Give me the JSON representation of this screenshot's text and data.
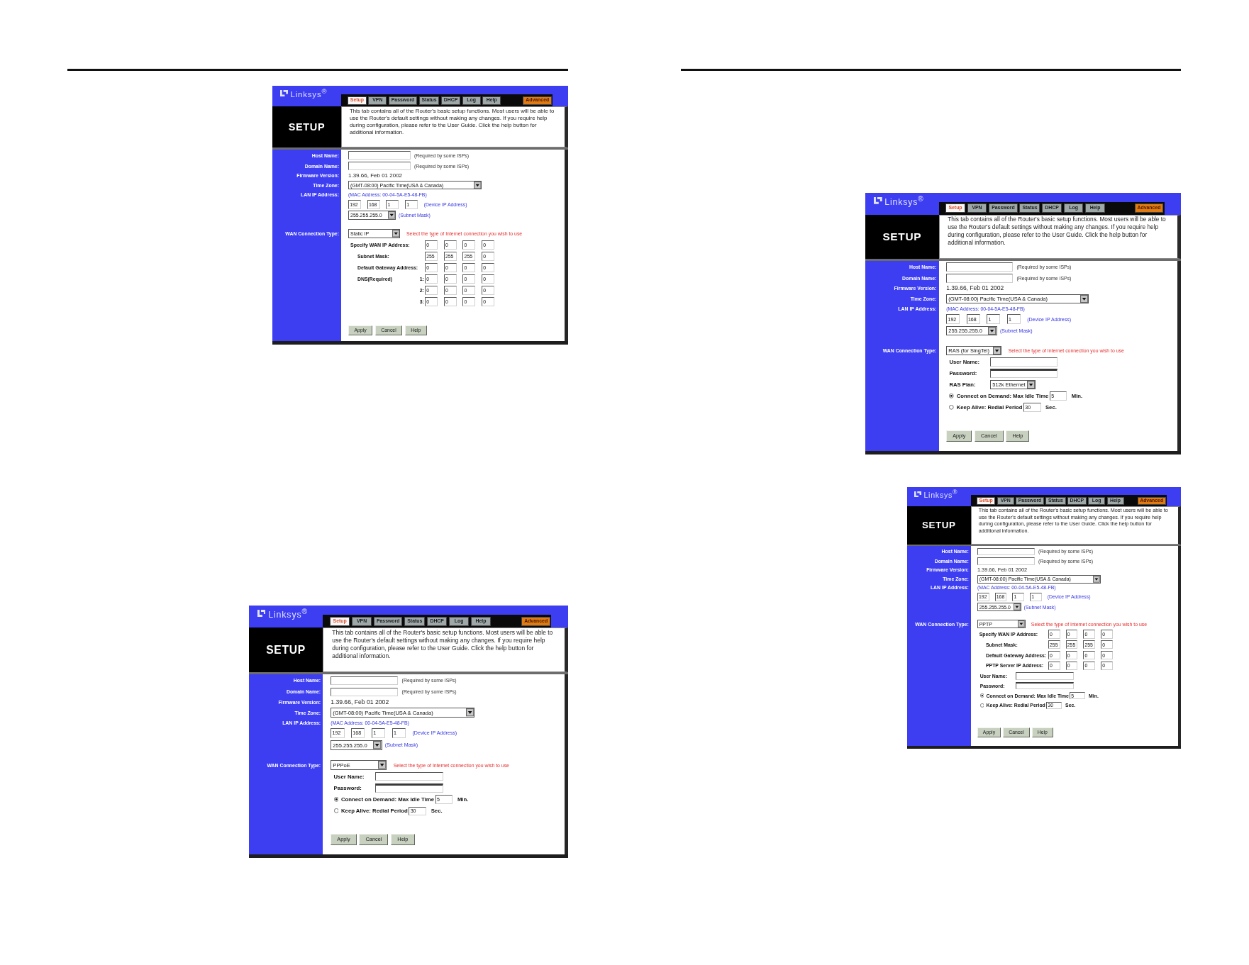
{
  "left_page": {
    "screenshots": [
      {
        "logo": "Linksys$^{®}$",
        "tabs": [
          {
            "label": "Setup",
            "kind": "plain",
            "selected": true
          },
          {
            "label": "VPN",
            "kind": "plain",
            "selected": false
          },
          {
            "label": "Password",
            "kind": "plain",
            "selected": false
          },
          {
            "label": "Status",
            "kind": "plain",
            "selected": false
          },
          {
            "label": "DHCP",
            "kind": "plain",
            "selected": false
          },
          {
            "label": "Log",
            "kind": "plain",
            "selected": false
          },
          {
            "label": "Help",
            "kind": "plain",
            "selected": false
          },
          {
            "label": "Advanced",
            "kind": "accent",
            "selected": false
          }
        ],
        "title": "SETUP",
        "description": "This tab contains all of the Router's basic setup functions. Most users will be able to use the Router's default settings without making any changes. If you require help during configuration, please refer to the User Guide. Click the help button for additional information.",
        "host_name": {
          "label": "Host Name:",
          "note": "(Required by some ISPs)"
        },
        "domain_name": {
          "label": "Domain Name:",
          "note": "(Required by some ISPs)"
        },
        "firmware_version": {
          "label": "Firmware Version:",
          "value": "1.39.66, Feb 01 2002"
        },
        "time_zone": {
          "label": "Time Zone:",
          "value": "(GMT-08:00) Pacific Time(USA & Canada)"
        },
        "lan_ip_address": {
          "label": "LAN IP Address:",
          "mac_address": "(MAC Address: 00-04-5A-E5-48-FB)",
          "octets": [
            "192",
            "168",
            "1",
            "1"
          ],
          "ip_note": "(Device IP Address)",
          "subnet_mask": "255.255.255.0",
          "mask_note": "(Subnet Mask)"
        },
        "wan_connection_type": {
          "label": "WAN Connection Type:",
          "value": "Static IP",
          "hint": "Select the type of Internet connection you wish to use"
        },
        "wan_rows": [
          {
            "kind": "address",
            "label": "Specify WAN IP Address:",
            "octets": [
              "0",
              "0",
              "0",
              "0"
            ]
          },
          {
            "kind": "subaddress",
            "label": "Subnet Mask:",
            "octets": [
              "255",
              "255",
              "255",
              "0"
            ]
          },
          {
            "kind": "subaddress",
            "label": "Default Gateway Address:",
            "octets": [
              "0",
              "0",
              "0",
              "0"
            ]
          },
          {
            "kind": "dns",
            "label": "DNS(Required)",
            "servers": [
              {
                "index": "1:",
                "octets": [
                  "0",
                  "0",
                  "0",
                  "0"
                ]
              },
              {
                "index": "2:",
                "octets": [
                  "0",
                  "0",
                  "0",
                  "0"
                ]
              },
              {
                "index": "3:",
                "octets": [
                  "0",
                  "0",
                  "0",
                  "0"
                ]
              }
            ]
          }
        ],
        "buttons": [
          "Apply",
          "Cancel",
          "Help"
        ]
      },
      {
        "logo": "Linksys$^{®}$",
        "tabs": [
          {
            "label": "Setup",
            "kind": "plain",
            "selected": true
          },
          {
            "label": "VPN",
            "kind": "plain",
            "selected": false
          },
          {
            "label": "Password",
            "kind": "plain",
            "selected": false
          },
          {
            "label": "Status",
            "kind": "plain",
            "selected": false
          },
          {
            "label": "DHCP",
            "kind": "plain",
            "selected": false
          },
          {
            "label": "Log",
            "kind": "plain",
            "selected": false
          },
          {
            "label": "Help",
            "kind": "plain",
            "selected": false
          },
          {
            "label": "Advanced",
            "kind": "accent",
            "selected": false
          }
        ],
        "title": "SETUP",
        "description": "This tab contains all of the Router's basic setup functions. Most users will be able to use the Router's default settings without making any changes. If you require help during configuration, please refer to the User Guide. Click the help button for additional information.",
        "host_name": {
          "label": "Host Name:",
          "note": "(Required by some ISPs)"
        },
        "domain_name": {
          "label": "Domain Name:",
          "note": "(Required by some ISPs)"
        },
        "firmware_version": {
          "label": "Firmware Version:",
          "value": "1.39.66, Feb 01 2002"
        },
        "time_zone": {
          "label": "Time Zone:",
          "value": "(GMT-08:00) Pacific Time(USA & Canada)"
        },
        "lan_ip_address": {
          "label": "LAN IP Address:",
          "mac_address": "(MAC Address: 00-04-5A-E5-48-FB)",
          "octets": [
            "192",
            "168",
            "1",
            "1"
          ],
          "ip_note": "(Device IP Address)",
          "subnet_mask": "255.255.255.0",
          "mask_note": "(Subnet Mask)"
        },
        "wan_connection_type": {
          "label": "WAN Connection Type:",
          "value": "PPPoE",
          "hint": "Select the type of Internet connection you wish to use"
        },
        "wan_rows": [
          {
            "kind": "text",
            "label": "User Name:"
          },
          {
            "kind": "password",
            "label": "Password:"
          },
          {
            "kind": "radio",
            "label": "Connect on Demand: Max Idle Time",
            "value": "5",
            "unit": "Min.",
            "selected": true
          },
          {
            "kind": "radio",
            "label": "Keep Alive: Redial Period",
            "value": "30",
            "unit": "Sec.",
            "selected": false
          }
        ],
        "buttons": [
          "Apply",
          "Cancel",
          "Help"
        ]
      }
    ]
  },
  "right_page": {
    "screenshots": [
      {
        "logo": "Linksys$^{®}$",
        "tabs": [
          {
            "label": "Setup",
            "kind": "plain",
            "selected": true
          },
          {
            "label": "VPN",
            "kind": "plain",
            "selected": false
          },
          {
            "label": "Password",
            "kind": "plain",
            "selected": false
          },
          {
            "label": "Status",
            "kind": "plain",
            "selected": false
          },
          {
            "label": "DHCP",
            "kind": "plain",
            "selected": false
          },
          {
            "label": "Log",
            "kind": "plain",
            "selected": false
          },
          {
            "label": "Help",
            "kind": "plain",
            "selected": false
          },
          {
            "label": "Advanced",
            "kind": "accent",
            "selected": false
          }
        ],
        "title": "SETUP",
        "description": "This tab contains all of the Router's basic setup functions. Most users will be able to use the Router's default settings without making any changes. If you require help during configuration, please refer to the User Guide. Click the help button for additional information.",
        "host_name": {
          "label": "Host Name:",
          "note": "(Required by some ISPs)"
        },
        "domain_name": {
          "label": "Domain Name:",
          "note": "(Required by some ISPs)"
        },
        "firmware_version": {
          "label": "Firmware Version:",
          "value": "1.39.66, Feb 01 2002"
        },
        "time_zone": {
          "label": "Time Zone:",
          "value": "(GMT-08:00) Pacific Time(USA & Canada)"
        },
        "lan_ip_address": {
          "label": "LAN IP Address:",
          "mac_address": "(MAC Address: 00-04-5A-E5-48-FB)",
          "octets": [
            "192",
            "168",
            "1",
            "1"
          ],
          "ip_note": "(Device IP Address)",
          "subnet_mask": "255.255.255.0",
          "mask_note": "(Subnet Mask)"
        },
        "wan_connection_type": {
          "label": "WAN Connection Type:",
          "value": "RAS (for SingTel)",
          "hint": "Select the type of Internet connection you wish to use"
        },
        "wan_rows": [
          {
            "kind": "text",
            "label": "User Name:"
          },
          {
            "kind": "password",
            "label": "Password:"
          },
          {
            "kind": "select",
            "label": "RAS Plan:",
            "value": "512k Ethernet"
          },
          {
            "kind": "radio",
            "label": "Connect on Demand: Max Idle Time",
            "value": "5",
            "unit": "Min.",
            "selected": true
          },
          {
            "kind": "radio",
            "label": "Keep Alive: Redial Period",
            "value": "30",
            "unit": "Sec.",
            "selected": false
          }
        ],
        "buttons": [
          "Apply",
          "Cancel",
          "Help"
        ]
      },
      {
        "logo": "Linksys$^{®}$",
        "tabs": [
          {
            "label": "Setup",
            "kind": "plain",
            "selected": true
          },
          {
            "label": "VPN",
            "kind": "plain",
            "selected": false
          },
          {
            "label": "Password",
            "kind": "plain",
            "selected": false
          },
          {
            "label": "Status",
            "kind": "plain",
            "selected": false
          },
          {
            "label": "DHCP",
            "kind": "plain",
            "selected": false
          },
          {
            "label": "Log",
            "kind": "plain",
            "selected": false
          },
          {
            "label": "Help",
            "kind": "plain",
            "selected": false
          },
          {
            "label": "Advanced",
            "kind": "accent",
            "selected": false
          }
        ],
        "title": "SETUP",
        "description": "This tab contains all of the Router's basic setup functions. Most users will be able to use the Router's default settings without making any changes. If you require help during configuration, please refer to the User Guide. Click the help button for additional information.",
        "host_name": {
          "label": "Host Name:",
          "note": "(Required by some ISPs)"
        },
        "domain_name": {
          "label": "Domain Name:",
          "note": "(Required by some ISPs)"
        },
        "firmware_version": {
          "label": "Firmware Version:",
          "value": "1.39.66, Feb 01 2002"
        },
        "time_zone": {
          "label": "Time Zone:",
          "value": "(GMT-08:00) Pacific Time(USA & Canada)"
        },
        "lan_ip_address": {
          "label": "LAN IP Address:",
          "mac_address": "(MAC Address: 00-04-5A-E5-48-FB)",
          "octets": [
            "192",
            "168",
            "1",
            "1"
          ],
          "ip_note": "(Device IP Address)",
          "subnet_mask": "255.255.255.0",
          "mask_note": "(Subnet Mask)"
        },
        "wan_connection_type": {
          "label": "WAN Connection Type:",
          "value": "PPTP",
          "hint": "Select the type of Internet connection you wish to use"
        },
        "wan_rows": [
          {
            "kind": "address",
            "label": "Specify WAN IP Address:",
            "octets": [
              "0",
              "0",
              "0",
              "0"
            ]
          },
          {
            "kind": "subaddress",
            "label": "Subnet Mask:",
            "octets": [
              "255",
              "255",
              "255",
              "0"
            ]
          },
          {
            "kind": "subaddress",
            "label": "Default Gateway Address:",
            "octets": [
              "0",
              "0",
              "0",
              "0"
            ]
          },
          {
            "kind": "subaddress",
            "label": "PPTP Server IP Address:",
            "octets": [
              "0",
              "0",
              "0",
              "0"
            ]
          },
          {
            "kind": "text",
            "label": "User Name:"
          },
          {
            "kind": "password",
            "label": "Password:"
          },
          {
            "kind": "radio",
            "label": "Connect on Demand: Max Idle Time",
            "value": "5",
            "unit": "Min.",
            "selected": true
          },
          {
            "kind": "radio",
            "label": "Keep Alive: Redial Period",
            "value": "30",
            "unit": "Sec.",
            "selected": false
          }
        ],
        "buttons": [
          "Apply",
          "Cancel",
          "Help"
        ]
      }
    ]
  }
}
